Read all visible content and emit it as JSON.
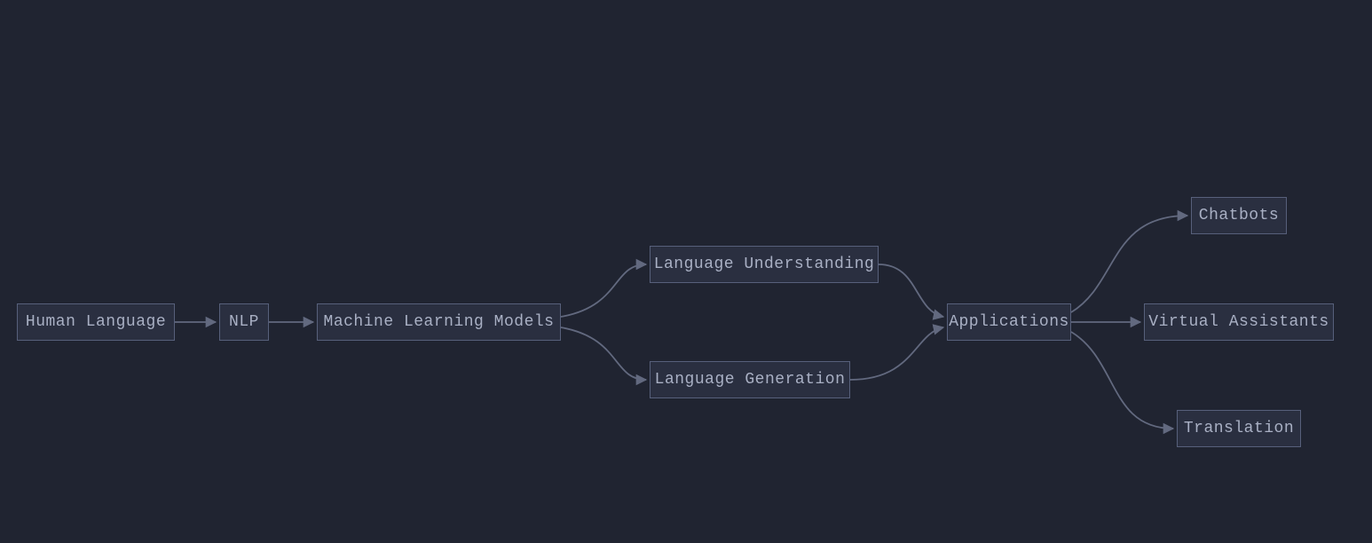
{
  "nodes": {
    "human_language": {
      "label": "Human Language"
    },
    "nlp": {
      "label": "NLP"
    },
    "mlm": {
      "label": "Machine Learning Models"
    },
    "lu": {
      "label": "Language Understanding"
    },
    "lg": {
      "label": "Language Generation"
    },
    "apps": {
      "label": "Applications"
    },
    "chatbots": {
      "label": "Chatbots"
    },
    "va": {
      "label": "Virtual Assistants"
    },
    "translation": {
      "label": "Translation"
    }
  },
  "edges": [
    {
      "from": "human_language",
      "to": "nlp"
    },
    {
      "from": "nlp",
      "to": "mlm"
    },
    {
      "from": "mlm",
      "to": "lu"
    },
    {
      "from": "mlm",
      "to": "lg"
    },
    {
      "from": "lu",
      "to": "apps"
    },
    {
      "from": "lg",
      "to": "apps"
    },
    {
      "from": "apps",
      "to": "chatbots"
    },
    {
      "from": "apps",
      "to": "va"
    },
    {
      "from": "apps",
      "to": "translation"
    }
  ],
  "style": {
    "background": "#202431",
    "node_fill": "#2a2f40",
    "node_border": "#57607b",
    "text_color": "#a9b0c4",
    "edge_color": "#62697f"
  }
}
